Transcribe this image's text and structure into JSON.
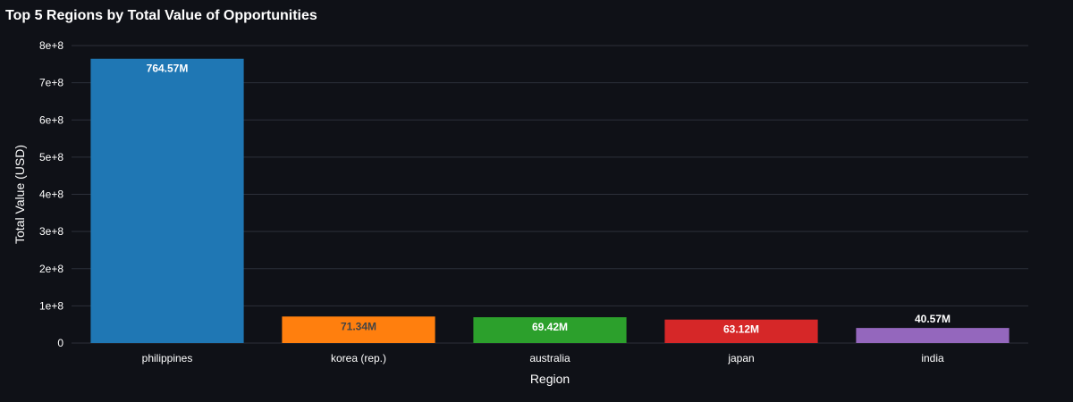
{
  "chart_data": {
    "type": "bar",
    "title": "Top 5 Regions by Total Value of Opportunities",
    "xlabel": "Region",
    "ylabel": "Total Value (USD)",
    "categories": [
      "philippines",
      "korea (rep.)",
      "australia",
      "japan",
      "india"
    ],
    "values": [
      764570000,
      71340000,
      69420000,
      63120000,
      40570000
    ],
    "data_labels": [
      "764.57M",
      "71.34M",
      "69.42M",
      "63.12M",
      "40.57M"
    ],
    "colors": [
      "#1f77b4",
      "#ff7f0e",
      "#2ca02c",
      "#d62728",
      "#9467bd"
    ],
    "label_colors": [
      "#ffffff",
      "#444444",
      "#ffffff",
      "#ffffff",
      "#ffffff"
    ],
    "label_positions": [
      "inside",
      "inside",
      "inside",
      "inside",
      "outside"
    ],
    "ylim": [
      0,
      800000000
    ],
    "yticks": [
      0,
      100000000,
      200000000,
      300000000,
      400000000,
      500000000,
      600000000,
      700000000,
      800000000
    ],
    "ytick_labels": [
      "0",
      "1e+8",
      "2e+8",
      "3e+8",
      "4e+8",
      "5e+8",
      "6e+8",
      "7e+8",
      "8e+8"
    ],
    "grid": true,
    "background": "#0f1117",
    "grid_color": "#2c303a"
  }
}
